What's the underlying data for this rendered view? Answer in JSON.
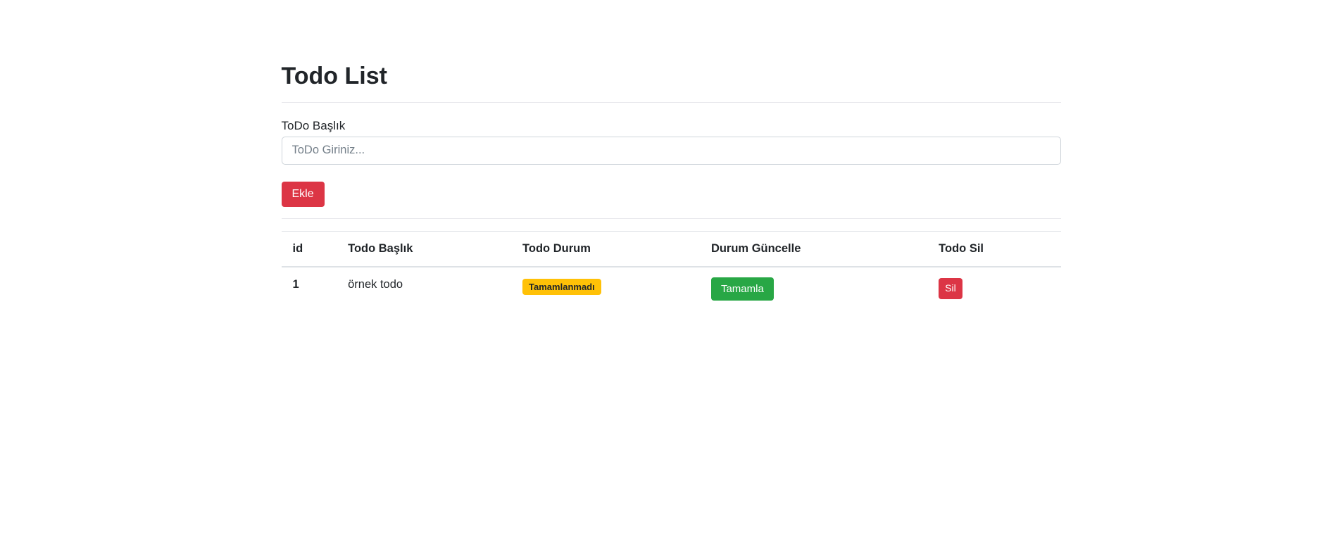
{
  "page": {
    "title": "Todo List"
  },
  "form": {
    "label": "ToDo Başlık",
    "input_value": "",
    "input_placeholder": "ToDo Giriniz...",
    "submit_label": "Ekle"
  },
  "table": {
    "headers": [
      "id",
      "Todo Başlık",
      "Todo Durum",
      "Durum Güncelle",
      "Todo Sil"
    ],
    "rows": [
      {
        "id": "1",
        "title": "örnek todo",
        "status_label": "Tamamlanmadı",
        "complete_label": "Tamamla",
        "delete_label": "Sil"
      }
    ]
  },
  "colors": {
    "danger": "#dc3545",
    "warning": "#ffc107",
    "success": "#28a745",
    "text": "#212529",
    "table-border": "#dee2e6",
    "input-border": "#ced4da"
  }
}
